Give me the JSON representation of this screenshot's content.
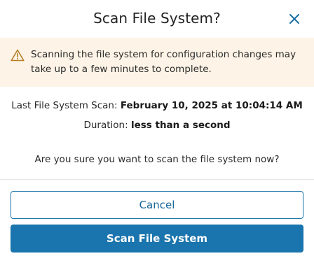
{
  "dialog": {
    "title": "Scan File System?",
    "close_icon": "close-icon"
  },
  "warning": {
    "icon": "warning-triangle-icon",
    "line1": "Scanning the file system for configuration changes may",
    "line2": "take up to a few minutes to complete."
  },
  "info": {
    "last_scan_label": "Last File System Scan:",
    "last_scan_value": "February 10, 2025 at 10:04:14 AM",
    "duration_label": "Duration:",
    "duration_value": "less than a second"
  },
  "question": "Are you sure you want to scan the file system now?",
  "buttons": {
    "cancel_label": "Cancel",
    "scan_label": "Scan File System"
  },
  "colors": {
    "accent": "#1a74ad",
    "warning_bg": "#fdf3e6",
    "warning_icon": "#b8802a"
  }
}
